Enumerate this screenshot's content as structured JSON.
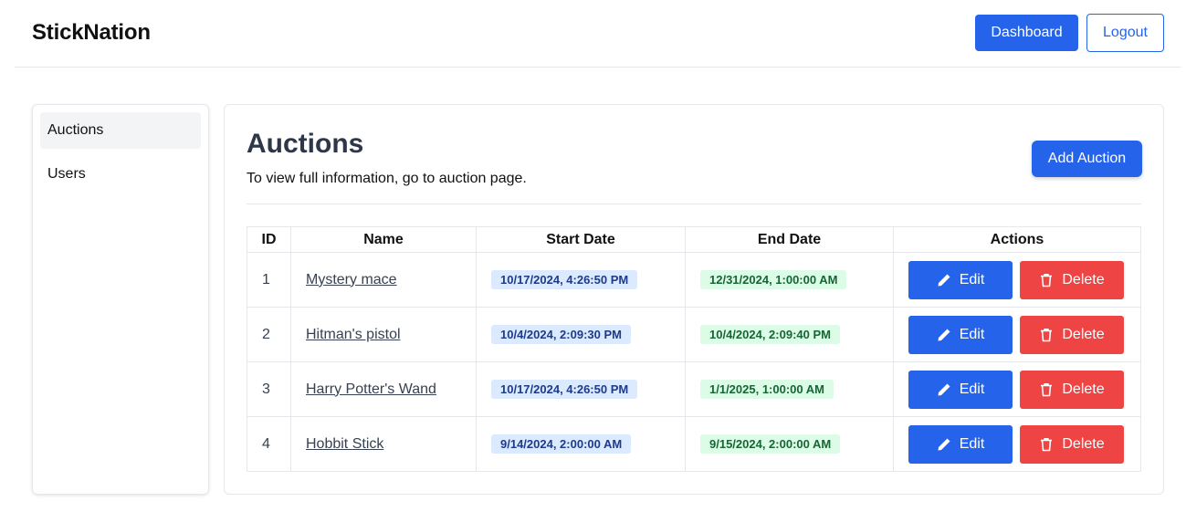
{
  "header": {
    "brand": "StickNation",
    "dashboard_label": "Dashboard",
    "logout_label": "Logout"
  },
  "sidebar": {
    "items": [
      {
        "label": "Auctions",
        "active": true
      },
      {
        "label": "Users",
        "active": false
      }
    ]
  },
  "main": {
    "title": "Auctions",
    "subtitle": "To view full information, go to auction page.",
    "add_label": "Add Auction",
    "table": {
      "headers": [
        "ID",
        "Name",
        "Start Date",
        "End Date",
        "Actions"
      ],
      "rows": [
        {
          "id": "1",
          "name": "Mystery mace",
          "start": "10/17/2024, 4:26:50 PM",
          "end": "12/31/2024, 1:00:00 AM"
        },
        {
          "id": "2",
          "name": "Hitman's pistol",
          "start": "10/4/2024, 2:09:30 PM",
          "end": "10/4/2024, 2:09:40 PM"
        },
        {
          "id": "3",
          "name": "Harry Potter's Wand",
          "start": "10/17/2024, 4:26:50 PM",
          "end": "1/1/2025, 1:00:00 AM"
        },
        {
          "id": "4",
          "name": "Hobbit Stick",
          "start": "9/14/2024, 2:00:00 AM",
          "end": "9/15/2024, 2:00:00 AM"
        }
      ],
      "edit_label": "Edit",
      "delete_label": "Delete"
    }
  },
  "icons": {
    "edit": "pencil-icon",
    "delete": "trash-icon"
  },
  "colors": {
    "primary": "#2563eb",
    "danger": "#ef4444",
    "start_badge_bg": "#dbeafe",
    "end_badge_bg": "#dcfce7"
  }
}
